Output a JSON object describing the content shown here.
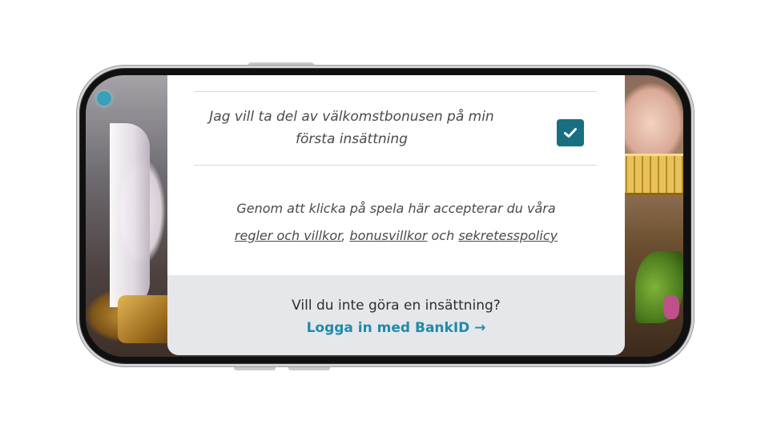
{
  "bonus": {
    "label": "Jag vill ta del av välkomstbonusen på min första insättning",
    "checked": true
  },
  "terms": {
    "prefix": "Genom att klicka på spela här accepterar du våra",
    "link_rules": "regler och villkor",
    "sep1": ",",
    "link_bonus": "bonusvillkor",
    "sep2": "och",
    "link_privacy": "sekretesspolicy"
  },
  "footer": {
    "question": "Vill du inte göra en insättning?",
    "login_label": "Logga in med BankID →"
  },
  "colors": {
    "checkbox": "#186f82",
    "link_accent": "#1f8bac",
    "footer_bg": "#e5e7ea"
  },
  "icons": {
    "checkbox": "check-icon"
  }
}
